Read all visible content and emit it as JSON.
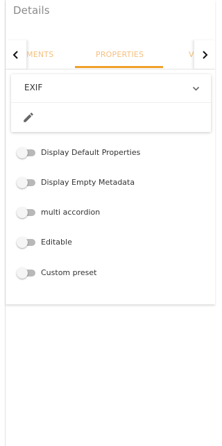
{
  "header": {
    "title": "Details"
  },
  "tabs": {
    "items": [
      {
        "label": "MENTS"
      },
      {
        "label": "PROPERTIES",
        "active": true
      },
      {
        "label": "VE"
      }
    ],
    "scroll_left_icon": "chevron-left-icon",
    "scroll_right_icon": "chevron-right-icon",
    "accent_color": "#f0a12b",
    "tab_text_color": "#f5bf7c"
  },
  "accordion": {
    "title": "EXIF",
    "expand_icon": "chevron-down-icon",
    "action_icon": "pencil-icon"
  },
  "toggles": [
    {
      "label": "Display Default Properties",
      "on": false
    },
    {
      "label": "Display Empty Metadata",
      "on": false
    },
    {
      "label": "multi accordion",
      "on": false
    },
    {
      "label": "Editable",
      "on": false
    },
    {
      "label": "Custom preset",
      "on": false
    }
  ]
}
